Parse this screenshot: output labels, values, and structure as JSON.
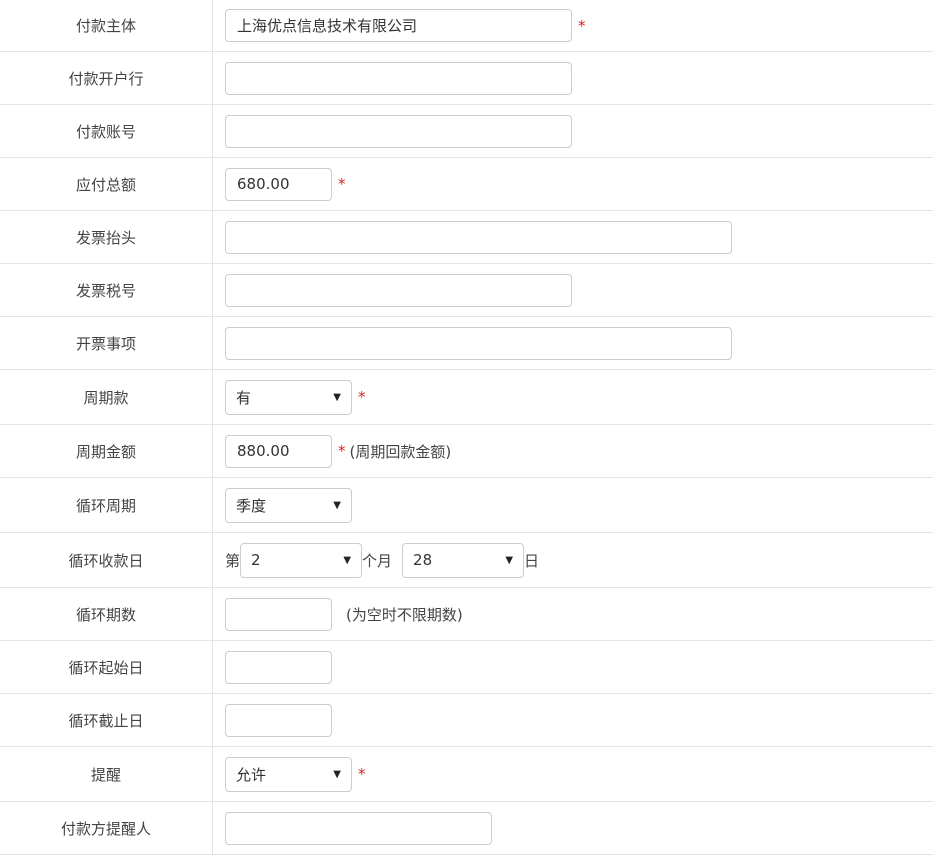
{
  "labels": {
    "payer_entity": "付款主体",
    "payer_bank": "付款开户行",
    "payer_account": "付款账号",
    "total_due": "应付总额",
    "invoice_title": "发票抬头",
    "invoice_tax_no": "发票税号",
    "invoice_item": "开票事项",
    "periodic": "周期款",
    "periodic_amount": "周期金额",
    "cycle_period": "循环周期",
    "cycle_receipt_day": "循环收款日",
    "cycle_count": "循环期数",
    "cycle_start": "循环起始日",
    "cycle_end": "循环截止日",
    "reminder": "提醒",
    "payer_reminder_person": "付款方提醒人"
  },
  "values": {
    "payer_entity": "上海优点信息技术有限公司",
    "payer_bank": "",
    "payer_account": "",
    "total_due": "680.00",
    "invoice_title": "",
    "invoice_tax_no": "",
    "invoice_item": "",
    "periodic": "有",
    "periodic_amount": "880.00",
    "cycle_period": "季度",
    "receipt_month": "2",
    "receipt_day": "28",
    "cycle_count": "",
    "cycle_start": "",
    "cycle_end": "",
    "reminder": "允许",
    "payer_reminder_person": ""
  },
  "text": {
    "required_mark": "*",
    "periodic_amount_note": "(周期回款金额)",
    "cycle_count_note": "(为空时不限期数)",
    "receipt_prefix": "第",
    "receipt_month_unit": "个月",
    "receipt_day_unit": "日"
  },
  "icons": {
    "dropdown": "▼"
  },
  "colors": {
    "required": "#e02020",
    "border": "#cccccc",
    "row_divider": "#e4e4e4"
  }
}
